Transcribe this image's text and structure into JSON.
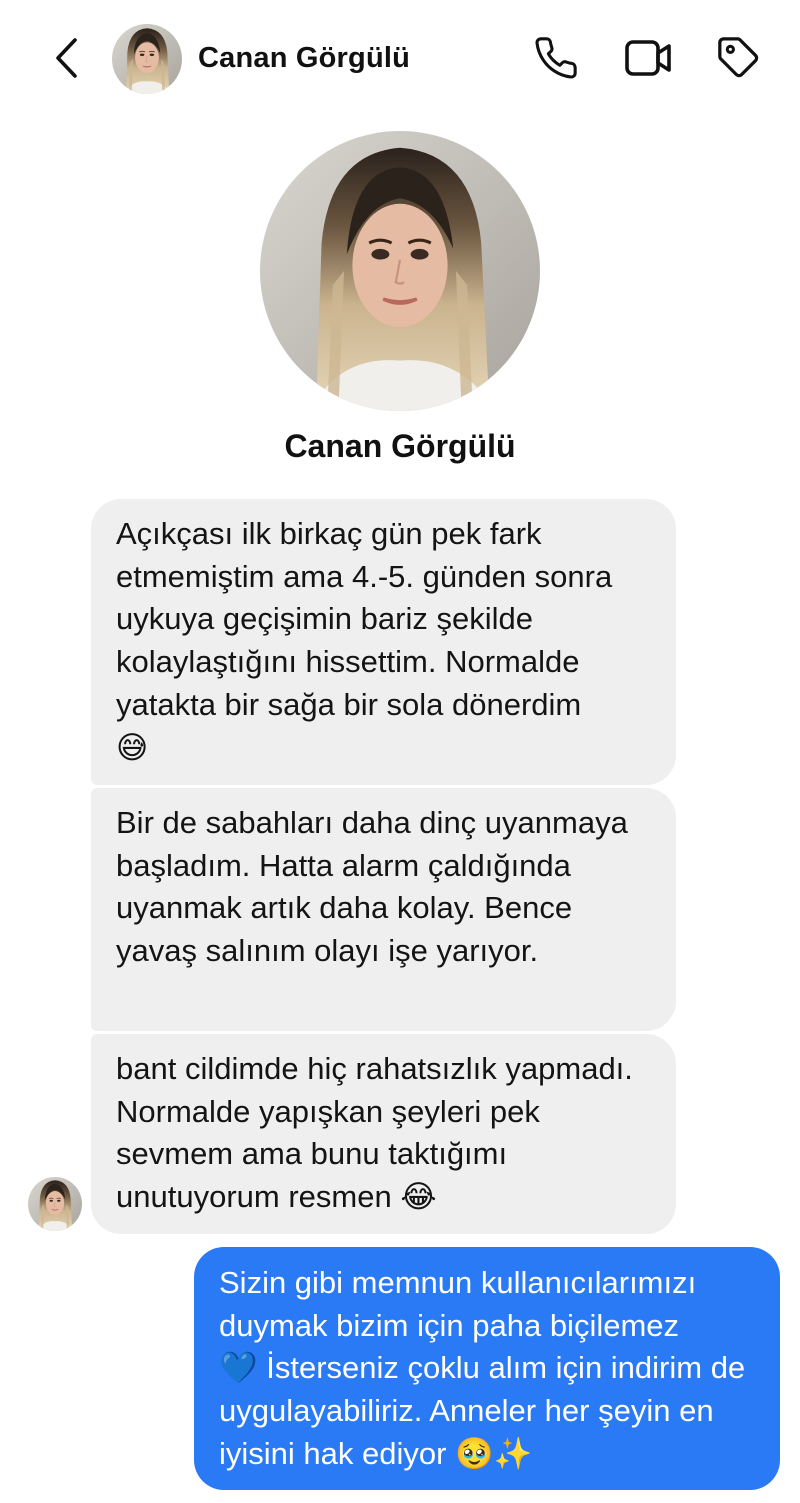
{
  "header": {
    "contact_name": "Canan Görgülü"
  },
  "profile": {
    "name": "Canan Görgülü"
  },
  "messages": [
    {
      "direction": "incoming",
      "text": "Açıkçası ilk birkaç gün pek fark etmemiştim ama 4.-5. günden sonra uykuya geçişimin bariz şekilde kolaylaştığını hissettim. Normalde yatakta bir sağa bir sola dönerdim",
      "emoji": "😅"
    },
    {
      "direction": "incoming",
      "text": "Bir de sabahları daha dinç uyanmaya başladım. Hatta alarm çaldığında uyanmak artık daha kolay. Bence yavaş salınım olayı işe yarıyor."
    },
    {
      "direction": "incoming",
      "text": "bant cildimde hiç rahatsızlık yapmadı. Normalde yapışkan şeyleri pek sevmem ama bunu taktığımı unutuyorum resmen",
      "emoji": "😂"
    },
    {
      "direction": "outgoing",
      "text_before_emoji": "Sizin gibi memnun kullanıcılarımızı duymak bizim için paha biçilemez",
      "emoji_middle": "💙",
      "text_after_emoji": "İsterseniz çoklu alım için indirim de uygulayabiliriz. Anneler her şeyin en iyisini hak ediyor",
      "emoji_end": "🥹✨"
    }
  ],
  "icons": {
    "back": "chevron-left-icon",
    "call": "phone-icon",
    "video": "video-camera-icon",
    "tag": "tag-icon"
  },
  "colors": {
    "incoming_bubble": "#efefef",
    "outgoing_bubble": "#2a7af5",
    "text": "#111111"
  }
}
